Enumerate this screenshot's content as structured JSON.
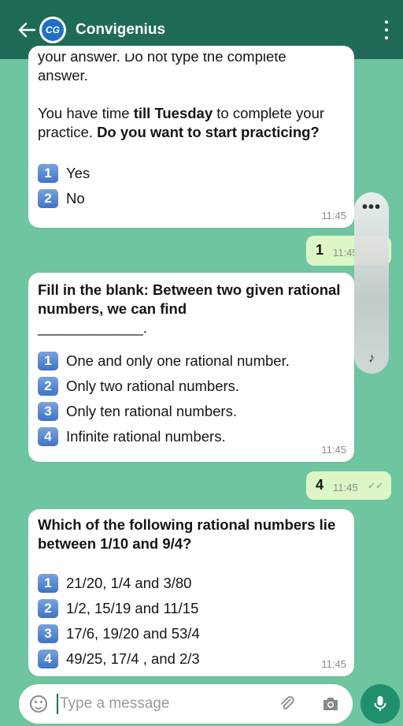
{
  "header": {
    "title": "Convigenius",
    "logo_text": "CG"
  },
  "messages": {
    "m1": {
      "cut_text": "your answer. Do not type the complete",
      "line1": "answer.",
      "p2_a": "You have time ",
      "p2_b": "till Tuesday",
      "p2_c": " to complete your practice. ",
      "p2_d": "Do you want to start practicing?",
      "options": [
        {
          "num": "1",
          "text": "Yes"
        },
        {
          "num": "2",
          "text": "No"
        }
      ],
      "time": "11:45"
    },
    "out1": {
      "text": "1",
      "time": "11:45"
    },
    "m2": {
      "question": "Fill in the blank: Between two given rational numbers, we can find",
      "blank": "_____________.",
      "options": [
        {
          "num": "1",
          "text": "One and only one rational number."
        },
        {
          "num": "2",
          "text": "Only two rational numbers."
        },
        {
          "num": "3",
          "text": "Only ten rational numbers."
        },
        {
          "num": "4",
          "text": "Infinite rational numbers."
        }
      ],
      "time": "11:45"
    },
    "out2": {
      "text": "4",
      "time": "11:45",
      "ticks": "✓✓"
    },
    "m3": {
      "question": "Which of the following rational numbers lie between   1/10 and 9/4?",
      "options": [
        {
          "num": "1",
          "text": "21/20, 1/4 and 3/80"
        },
        {
          "num": "2",
          "text": "1/2, 15/19 and 11/15"
        },
        {
          "num": "3",
          "text": "17/6, 19/20 and 53/4"
        },
        {
          "num": "4",
          "text": "49/25, 17/4 , and 2/3"
        }
      ],
      "time": "11:45"
    }
  },
  "overlay": {
    "menu_glyph": "•••",
    "note_glyph": "♪"
  },
  "input": {
    "placeholder": "Type a message"
  },
  "colors": {
    "header": "#1f6b57",
    "background": "#6fc5a0",
    "outgoing": "#dcf7c5",
    "accent": "#1f8f6e"
  }
}
